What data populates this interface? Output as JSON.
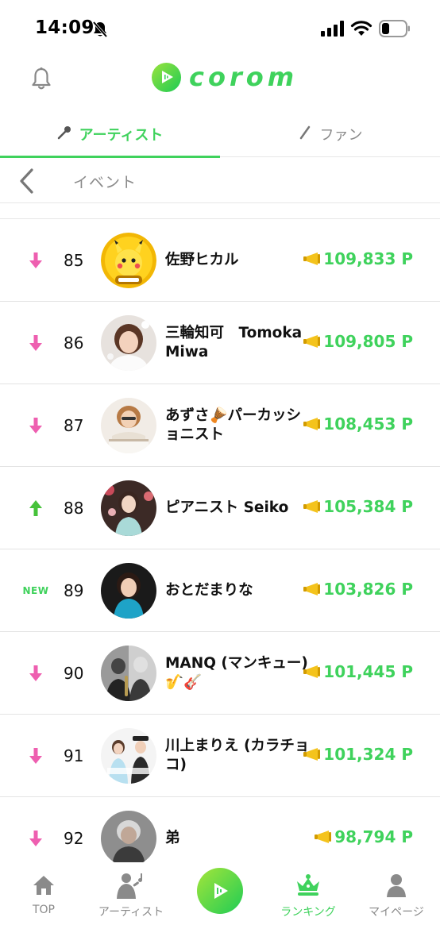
{
  "status_bar": {
    "time": "14:09"
  },
  "header": {
    "logo_text": "corom"
  },
  "tabs": [
    {
      "label": "アーティスト",
      "active": true
    },
    {
      "label": "ファン",
      "active": false
    }
  ],
  "sub_header": {
    "title": "イベント"
  },
  "rankings": [
    {
      "trend": "down",
      "trend_label": "",
      "rank": "85",
      "name": "佐野ヒカル",
      "points": "109,833 P"
    },
    {
      "trend": "down",
      "trend_label": "",
      "rank": "86",
      "name": "三輪知可　Tomoka Miwa",
      "points": "109,805 P"
    },
    {
      "trend": "down",
      "trend_label": "",
      "rank": "87",
      "name": "あずさ🪘パーカッショニスト",
      "points": "108,453 P"
    },
    {
      "trend": "up",
      "trend_label": "",
      "rank": "88",
      "name": "ピアニスト Seiko",
      "points": "105,384 P"
    },
    {
      "trend": "new",
      "trend_label": "NEW",
      "rank": "89",
      "name": "おとだまりな",
      "points": "103,826 P"
    },
    {
      "trend": "down",
      "trend_label": "",
      "rank": "90",
      "name": "MANQ (マンキュー) 🎷🎸",
      "points": "101,445 P"
    },
    {
      "trend": "down",
      "trend_label": "",
      "rank": "91",
      "name": "川上まりえ (カラチョコ)",
      "points": "101,324 P"
    },
    {
      "trend": "down",
      "trend_label": "",
      "rank": "92",
      "name": "弟",
      "points": "98,794 P"
    }
  ],
  "bottom_nav": [
    {
      "label": "TOP",
      "icon": "home-icon",
      "active": false
    },
    {
      "label": "アーティスト",
      "icon": "artist-icon",
      "active": false
    },
    {
      "label": "",
      "icon": "corom-play-icon",
      "active": false
    },
    {
      "label": "ランキング",
      "icon": "crown-icon",
      "active": true
    },
    {
      "label": "マイページ",
      "icon": "person-icon",
      "active": false
    }
  ],
  "colors": {
    "accent": "#3fd25c",
    "down": "#ee5fb0",
    "up": "#46c23a",
    "muted": "#8a8a8a"
  }
}
